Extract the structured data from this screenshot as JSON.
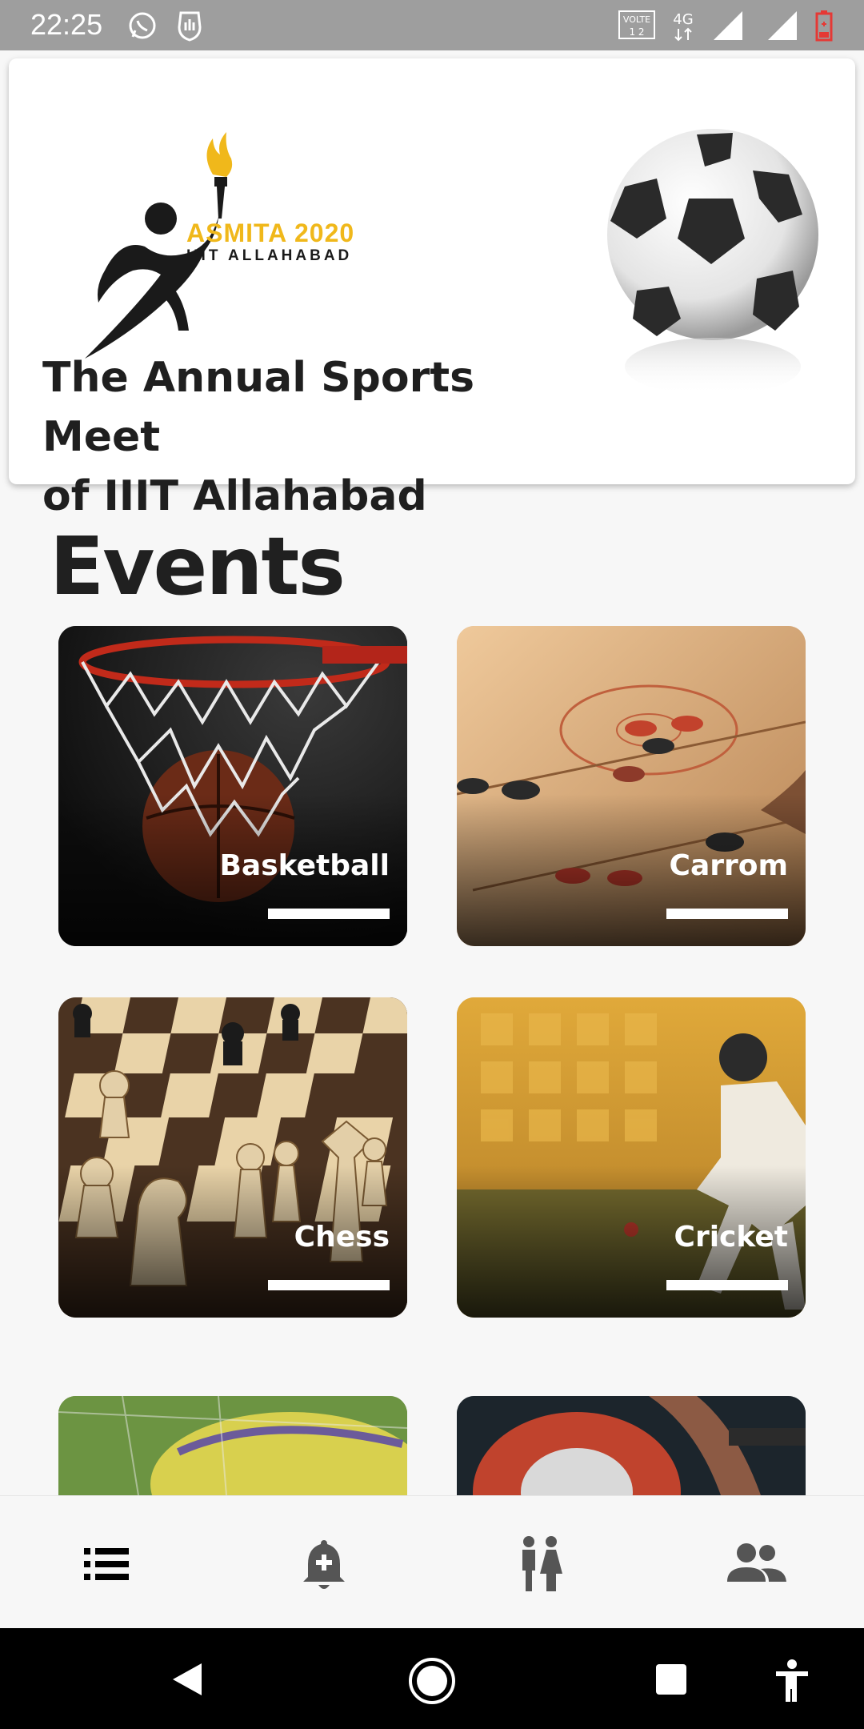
{
  "status_bar": {
    "time": "22:25",
    "icons": [
      "whatsapp-icon",
      "vpn-hand-icon",
      "volte-icon",
      "network-4g-icon",
      "signal-icon",
      "signal-icon",
      "battery-low-icon"
    ],
    "volte_label": "VOLTE",
    "network_label": "4G"
  },
  "header": {
    "logo_title": "ASMITA 2020",
    "logo_subtitle": "IIIT ALLAHABAD",
    "tagline_line1": "The Annual Sports Meet",
    "tagline_line2": "of IIIT Allahabad",
    "accent_color": "#f0b81b"
  },
  "events": {
    "title": "Events",
    "items": [
      {
        "label": "Basketball"
      },
      {
        "label": "Carrom"
      },
      {
        "label": "Chess"
      },
      {
        "label": "Cricket"
      },
      {
        "label": ""
      },
      {
        "label": ""
      }
    ]
  },
  "bottom_nav": {
    "items": [
      {
        "icon": "list-icon",
        "active": true
      },
      {
        "icon": "add-notification-icon",
        "active": false
      },
      {
        "icon": "couple-icon",
        "active": false
      },
      {
        "icon": "group-icon",
        "active": false
      }
    ]
  },
  "system_nav": {
    "items": [
      "back-icon",
      "home-icon",
      "recents-icon",
      "accessibility-icon"
    ]
  }
}
